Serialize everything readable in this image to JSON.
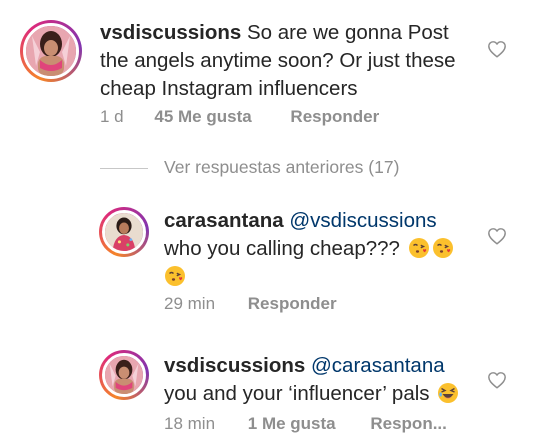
{
  "comments": [
    {
      "username": "vsdiscussions",
      "mention": "",
      "text": "So are we gonna Post the angels anytime soon? Or just these cheap Instagram influencers",
      "time": "1 d",
      "likes": "45 Me gusta",
      "reply_label": "Responder",
      "avatar_icon": "vsdiscussions-avatar",
      "has_story_ring": true
    },
    {
      "username": "carasantana",
      "mention": "@vsdiscussions",
      "text": "who you calling cheap???",
      "time": "29 min",
      "likes": "",
      "reply_label": "Responder",
      "avatar_icon": "carasantana-avatar",
      "has_story_ring": true,
      "emojis": [
        "kissing-heart-emoji",
        "kissing-heart-emoji",
        "kissing-heart-emoji"
      ]
    },
    {
      "username": "vsdiscussions",
      "mention": "@carasantana",
      "text": "you and your ‘influencer’ pals",
      "time": "18 min",
      "likes": "1 Me gusta",
      "reply_label": "Respon...",
      "avatar_icon": "vsdiscussions-avatar",
      "has_story_ring": true,
      "emojis": [
        "laughing-emoji"
      ]
    }
  ],
  "view_previous_replies": "Ver respuestas anteriores (17)",
  "colors": {
    "text": "#262626",
    "secondary": "#8e8e8e",
    "mention": "#00376b",
    "divider": "#c7c7c7"
  }
}
